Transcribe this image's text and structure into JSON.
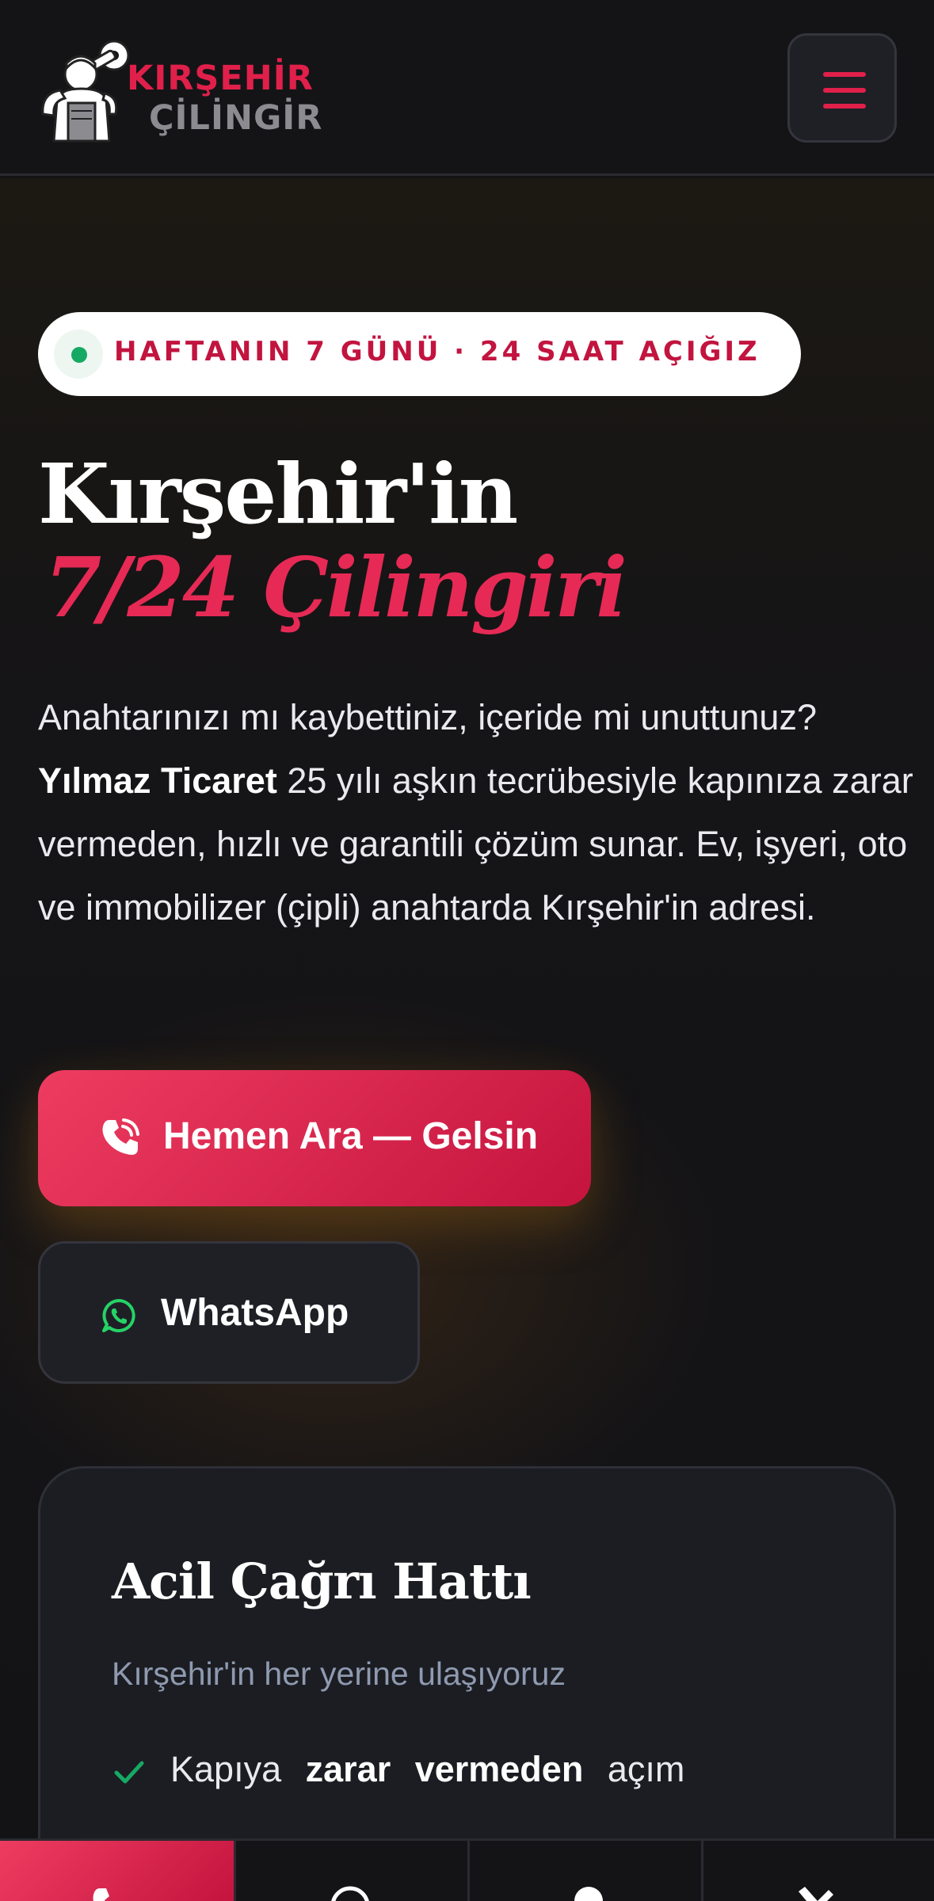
{
  "header": {
    "logo_line1": "KIRŞEHİR",
    "logo_line2": "ÇİLİNGİR"
  },
  "hero": {
    "badge": "HAFTANIN 7 GÜNÜ · 24 SAAT AÇIĞIZ",
    "title_line1": "Kırşehir'in",
    "title_line2": "7/24 Çilingiri",
    "desc_part1": "Anahtarınızı mı kaybettiniz, içeride mi unuttunuz?",
    "desc_bold": "Yılmaz Ticaret",
    "desc_part2": " 25 yılı aşkın tecrübesiyle kapınıza zarar vermeden, hızlı ve garantili çözüm sunar. Ev, işyeri, oto ve immobilizer (çipli) anahtarda Kırşehir'in adresi.",
    "call_button": "Hemen Ara — Gelsin",
    "whatsapp_button": "WhatsApp"
  },
  "emergency_card": {
    "title": "Acil Çağrı Hattı",
    "subtitle": "Kırşehir'in her yerine ulaşıyoruz",
    "item1_before": "Kapıya",
    "item1_bold": "zarar vermeden",
    "item1_after": "açım"
  },
  "bottom_nav": {
    "items": [
      "phone-icon",
      "whatsapp-icon",
      "location-pin-icon",
      "tools-icon"
    ]
  },
  "colors": {
    "accent": "#e0204a",
    "background": "#131316",
    "status_green": "#16a964",
    "whatsapp_green": "#25d366"
  }
}
